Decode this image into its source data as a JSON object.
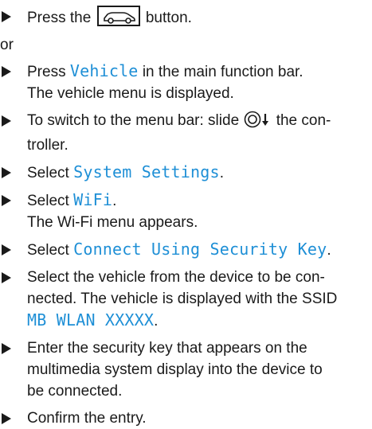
{
  "steps": [
    {
      "id": "press-car-button",
      "before": "Press the",
      "button_icon": "car-button-icon",
      "after": "button."
    },
    {
      "id": "or",
      "text": "or"
    },
    {
      "id": "press-vehicle",
      "before": "Press",
      "highlight": "Vehicle",
      "after": "in the main function bar.",
      "line2": "The vehicle menu is displayed."
    },
    {
      "id": "switch-menu-bar",
      "before": "To switch to the menu bar: slide",
      "controller_icon": "controller-slide-down-icon",
      "after": "the con-",
      "line2": "troller."
    },
    {
      "id": "select-system-settings",
      "before": "Select",
      "highlight": "System Settings",
      "after": "."
    },
    {
      "id": "select-wifi",
      "before": "Select",
      "highlight": "WiFi",
      "after": ".",
      "line2": "The Wi-Fi menu appears."
    },
    {
      "id": "select-connect",
      "before": "Select",
      "highlight": "Connect Using Security Key",
      "after": "."
    },
    {
      "id": "select-vehicle",
      "line1": "Select the vehicle from the device to be con-",
      "line2": "nected. The vehicle is displayed with the SSID",
      "highlight": "MB WLAN XXXXX",
      "after": "."
    },
    {
      "id": "enter-key",
      "line1": "Enter the security key that appears on the",
      "line2": "multimedia system display into the device to",
      "line3": "be connected."
    },
    {
      "id": "confirm",
      "text": "Confirm the entry."
    }
  ],
  "colors": {
    "highlight": "#1e8fd6",
    "text": "#1a1a1a"
  }
}
